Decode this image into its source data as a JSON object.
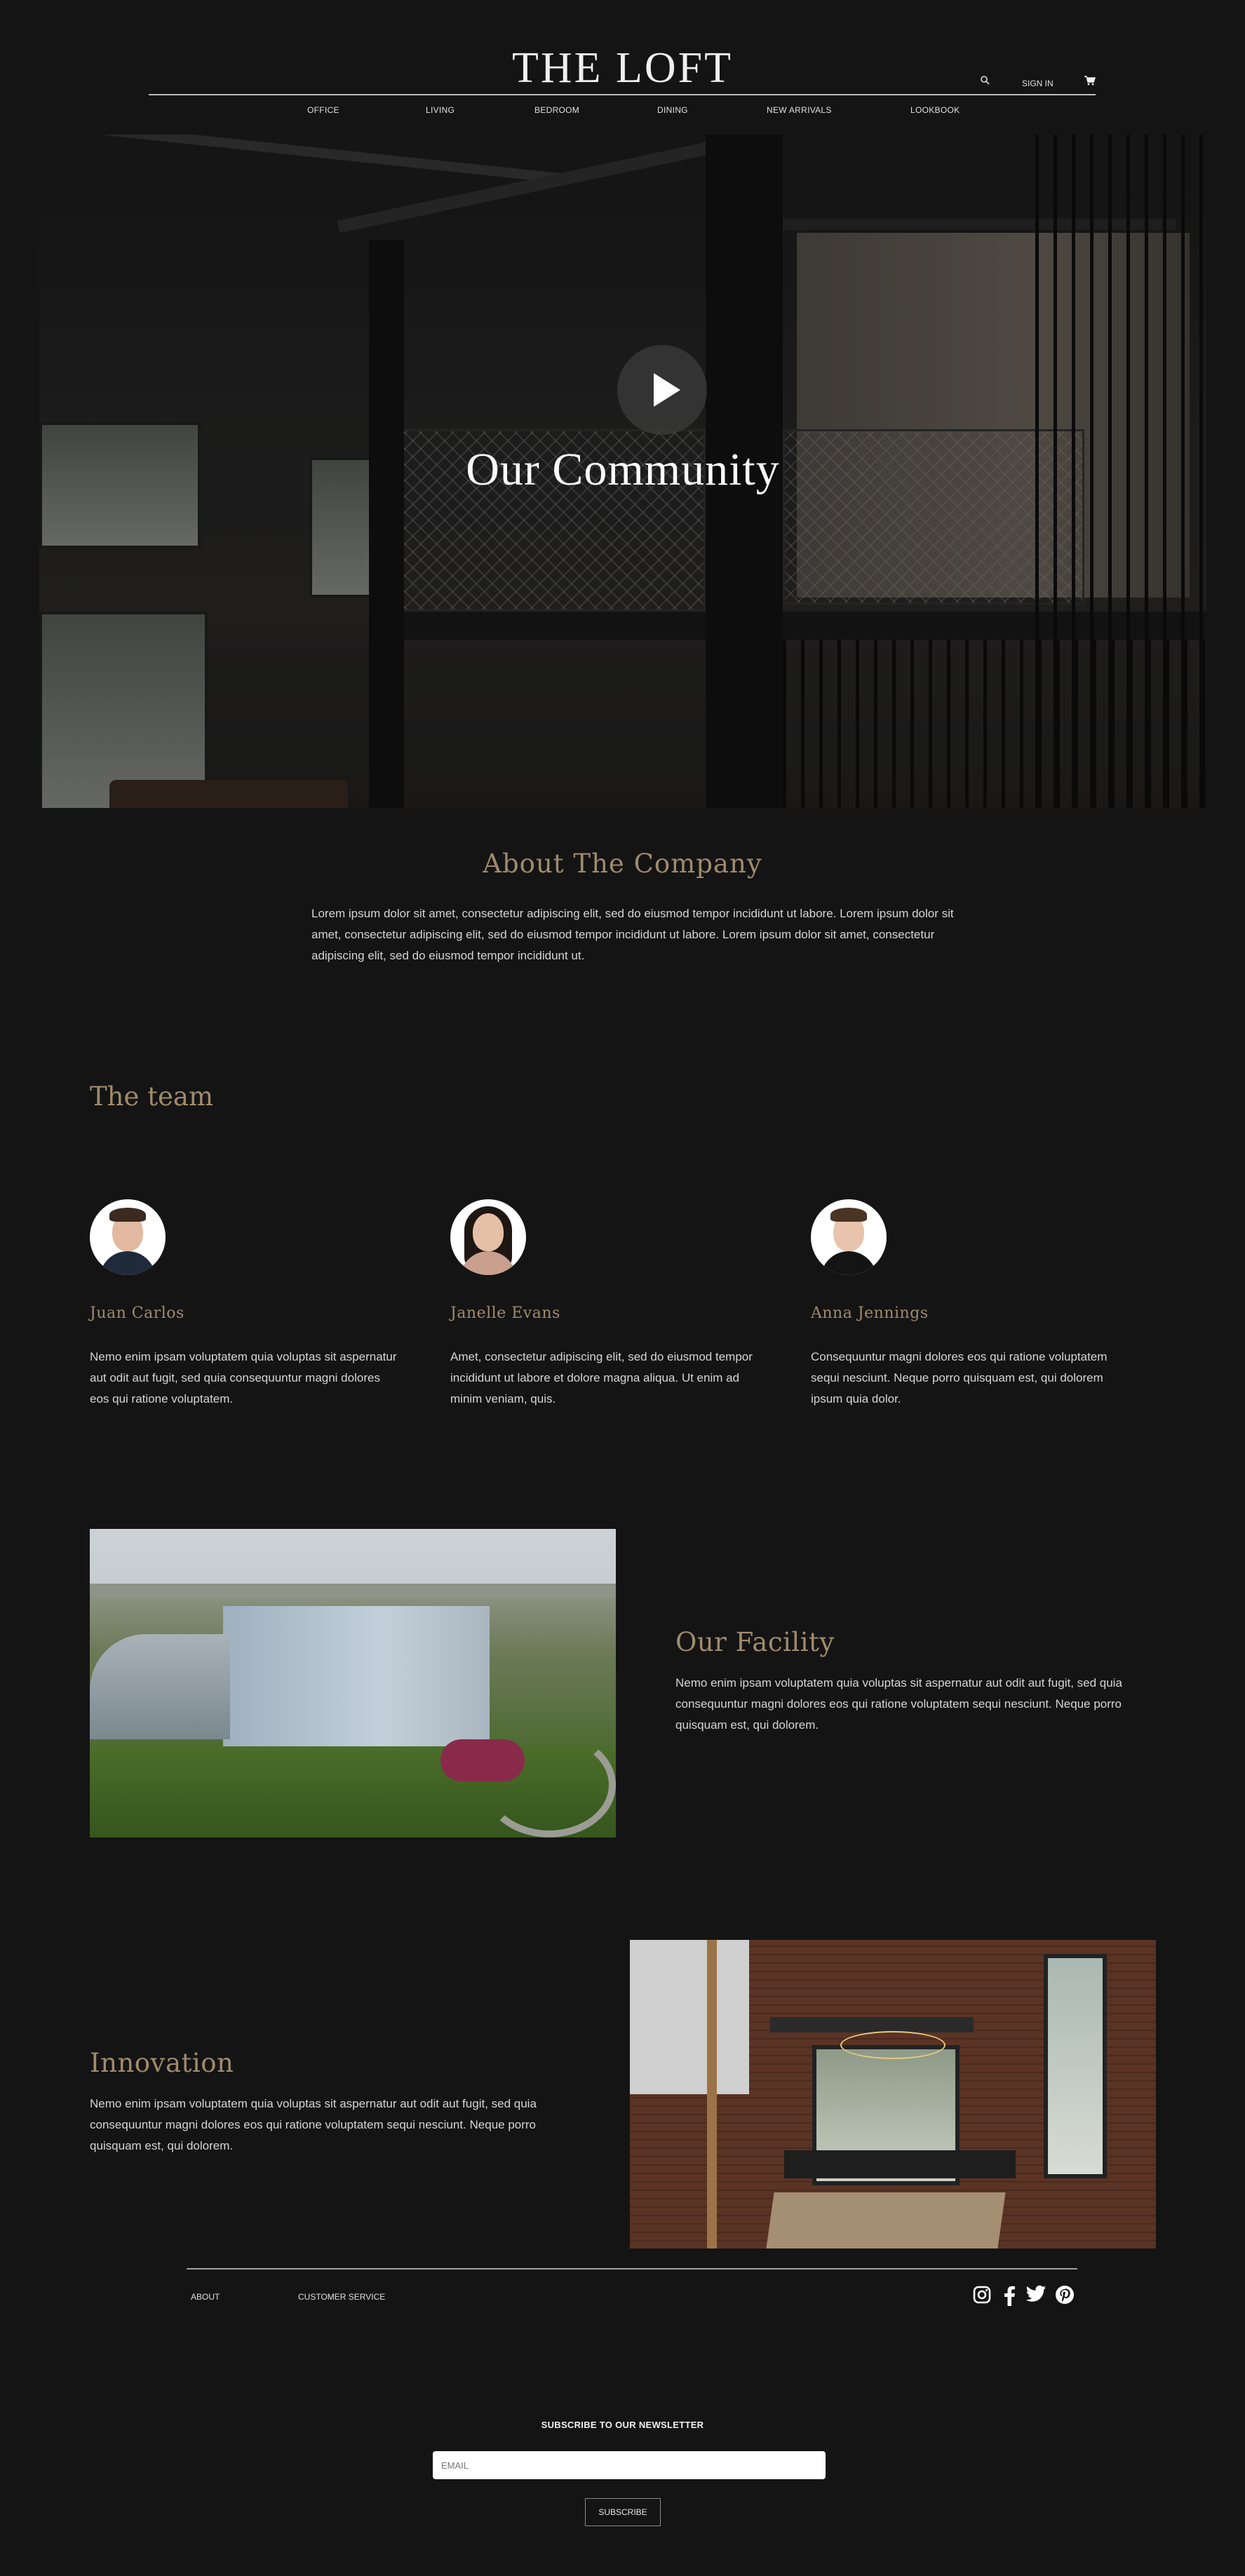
{
  "header": {
    "logo": "THE LOFT",
    "search_icon": "search-icon",
    "sign_in": "SIGN IN",
    "cart_icon": "cart-icon",
    "nav": [
      "OFFICE",
      "LIVING",
      "BEDROOM",
      "DINING",
      "NEW ARRIVALS",
      "LOOKBOOK"
    ]
  },
  "hero": {
    "play_icon": "play-icon",
    "title": "Our Community"
  },
  "about": {
    "title": "About The Company",
    "text": "Lorem ipsum dolor sit amet, consectetur adipiscing elit, sed do eiusmod tempor incididunt ut labore. Lorem ipsum dolor sit amet, consectetur adipiscing elit, sed do eiusmod tempor incididunt ut labore. Lorem ipsum dolor sit amet, consectetur adipiscing elit, sed do eiusmod tempor incididunt ut."
  },
  "team": {
    "title": "The team",
    "members": [
      {
        "name": "Juan Carlos",
        "text": "Nemo enim ipsam voluptatem quia voluptas sit aspernatur aut odit aut fugit, sed quia consequuntur magni dolores eos qui ratione voluptatem."
      },
      {
        "name": "Janelle Evans",
        "text": "Amet, consectetur adipiscing elit, sed do eiusmod tempor incididunt ut labore et dolore magna aliqua. Ut enim ad minim veniam, quis."
      },
      {
        "name": "Anna Jennings",
        "text": "Consequuntur magni dolores eos qui ratione voluptatem sequi nesciunt. Neque porro quisquam est, qui dolorem ipsum quia dolor."
      }
    ]
  },
  "facility": {
    "title": "Our Facility",
    "text": "Nemo enim ipsam voluptatem quia voluptas sit aspernatur aut odit aut fugit, sed quia consequuntur magni dolores eos qui ratione voluptatem sequi nesciunt. Neque porro quisquam est, qui dolorem."
  },
  "innovation": {
    "title": "Innovation",
    "text": "Nemo enim ipsam voluptatem quia voluptas sit aspernatur aut odit aut fugit, sed quia consequuntur magni dolores eos qui ratione voluptatem sequi nesciunt. Neque porro quisquam est, qui dolorem."
  },
  "footer": {
    "links": [
      "ABOUT",
      "CUSTOMER SERVICE"
    ],
    "social_icons": [
      "instagram-icon",
      "facebook-icon",
      "twitter-icon",
      "pinterest-icon"
    ],
    "newsletter_title": "SUBSCRIBE TO OUR NEWSLETTER",
    "email_placeholder": "EMAIL",
    "subscribe_label": "SUBSCRIBE"
  },
  "colors": {
    "background": "#141414",
    "accent": "#a08b6c"
  }
}
